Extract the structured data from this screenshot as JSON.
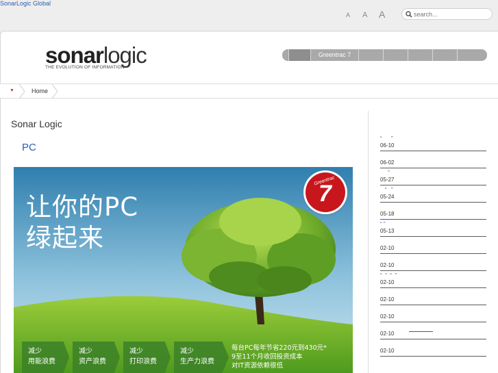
{
  "global": {
    "link": "SonarLogic Global"
  },
  "font_controls": {
    "small": "A",
    "medium": "A",
    "large": "A"
  },
  "search": {
    "placeholder": "search..."
  },
  "logo": {
    "sonar": "sonar",
    "logic": "logic",
    "tagline": "THE EVOLUTION OF INFORMATION"
  },
  "nav": {
    "items": [
      "",
      "",
      "Greentrac 7",
      "",
      "",
      "",
      "",
      ""
    ],
    "active_index": 1
  },
  "breadcrumb": {
    "home": "Home"
  },
  "main": {
    "title": "Sonar Logic",
    "subtitle": "PC"
  },
  "banner": {
    "headline_line1": "让你的PC",
    "headline_line2": "绿起来",
    "badge_brand": "Greentrac",
    "badge_number": "7",
    "chips": [
      {
        "line1": "减少",
        "line2": "用能浪费"
      },
      {
        "line1": "减少",
        "line2": "资产浪费"
      },
      {
        "line1": "减少",
        "line2": "打印浪费"
      },
      {
        "line1": "减少",
        "line2": "生产力浪费"
      }
    ],
    "promo_line1": "每台PC每年节省220元到430元*",
    "promo_line2": "9至11个月收回投资成本",
    "promo_line3": "对IT资源依赖很低"
  },
  "sidebar": {
    "news": [
      {
        "quote": "“      ”",
        "date": "06-10"
      },
      {
        "quote": "",
        "date": "06-02"
      },
      {
        "quote": "     ”",
        "date": "05-27"
      },
      {
        "quote": "   “   ”",
        "date": "05-24"
      },
      {
        "quote": "",
        "date": "05-18"
      },
      {
        "quote": "“ ”",
        "date": "05-13"
      },
      {
        "quote": "",
        "date": "02-10"
      },
      {
        "quote": "",
        "date": "02-10"
      },
      {
        "quote": "“  ”  “  ”",
        "date": "02-10"
      },
      {
        "quote": "",
        "date": "02-10"
      },
      {
        "quote": "",
        "date": "02-10"
      },
      {
        "quote": "",
        "date": "02-10"
      },
      {
        "quote": "",
        "date": "02-10"
      }
    ]
  },
  "colors": {
    "link": "#2a5db0",
    "nav_bg": "#a9a9a9",
    "nav_active": "#8e8e8e",
    "badge": "#c8161d"
  }
}
